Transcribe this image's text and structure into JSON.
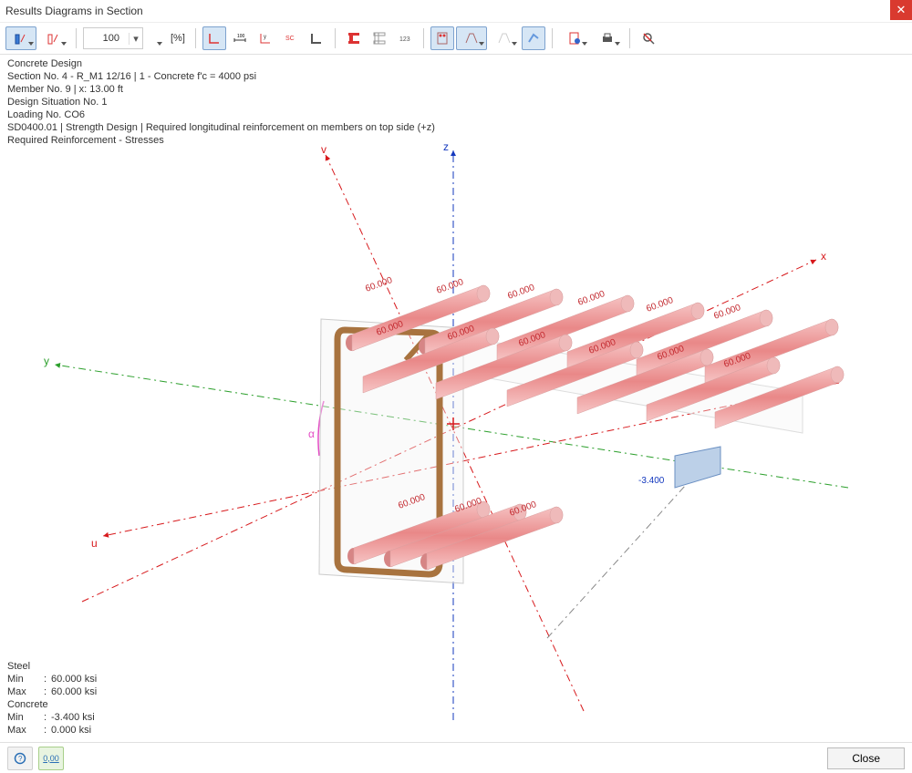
{
  "window_title": "Results Diagrams in Section",
  "toolbar": {
    "zoom_value": "100",
    "zoom_unit": "[%]"
  },
  "info": {
    "line1": "Concrete Design",
    "line2": "Section No. 4 - R_M1 12/16 | 1 - Concrete f'c = 4000 psi",
    "line3": "Member No. 9 | x: 13.00 ft",
    "line4": "Design Situation No. 1",
    "line5": "Loading No. CO6",
    "line6": "SD0400.01 | Strength Design | Required longitudinal reinforcement on members on top side (+z)",
    "line7": "Required Reinforcement - Stresses"
  },
  "axes": {
    "x": "x",
    "y": "y",
    "z": "z",
    "u": "u",
    "v": "v",
    "alpha": "α"
  },
  "bars": {
    "top_row1": [
      "60.000",
      "60.000",
      "60.000",
      "60.000",
      "60.000",
      "60.000"
    ],
    "top_row2": [
      "60.000",
      "60.000",
      "60.000",
      "60.000",
      "60.000",
      "60.000"
    ],
    "bottom_row": [
      "60.000",
      "60.000",
      "60.000"
    ],
    "conc_value": "-3.400"
  },
  "legend": {
    "steel_title": "Steel",
    "steel_min_k": "Min",
    "steel_min_v": "60.000 ksi",
    "steel_max_k": "Max",
    "steel_max_v": "60.000 ksi",
    "conc_title": "Concrete",
    "conc_min_k": "Min",
    "conc_min_v": "-3.400 ksi",
    "conc_max_k": "Max",
    "conc_max_v": "0.000 ksi"
  },
  "close_label": "Close"
}
